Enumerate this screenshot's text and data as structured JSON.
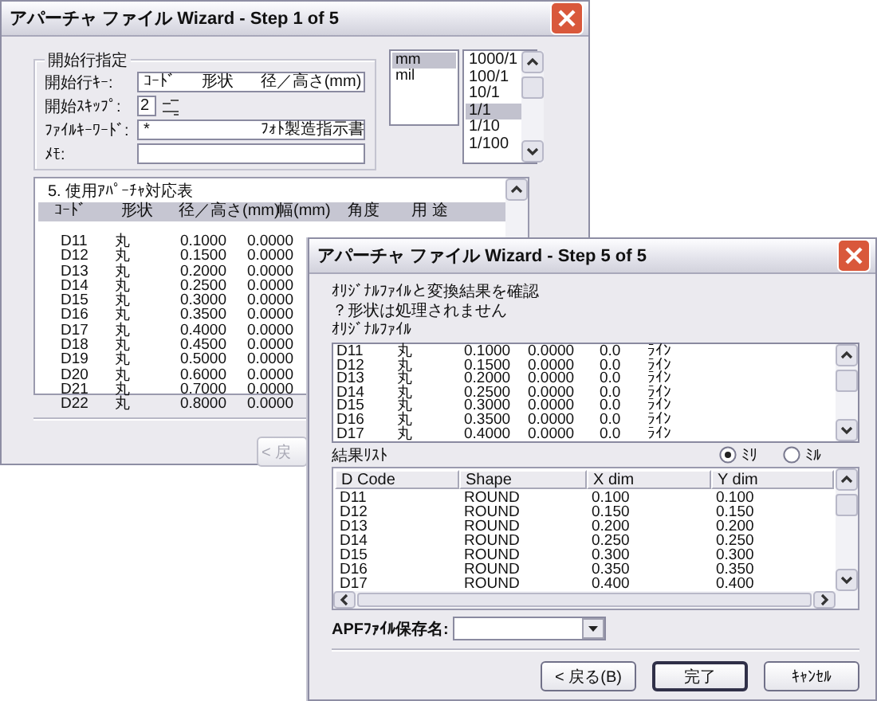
{
  "step1_window": {
    "title": "アパーチャ ファイル Wizard - Step 1 of 5",
    "start_group": {
      "title": "開始行指定",
      "fields": [
        {
          "kind": "text",
          "label": "開始行ｷｰ:",
          "value": "ｺｰﾄﾞ      形状      径／高さ(mm)"
        },
        {
          "kind": "spin",
          "label": "開始ｽｷｯﾌﾟ:",
          "value": "2"
        },
        {
          "kind": "text",
          "label": "ﾌｧｲﾙｷｰﾜｰﾄﾞ:",
          "value": "*                         ﾌｫﾄ製造指示書"
        },
        {
          "kind": "text",
          "label": "ﾒﾓ:"
        }
      ]
    },
    "unit_list": [
      {
        "label": "mm",
        "selected": true
      },
      {
        "label": "mil",
        "selected": false
      }
    ],
    "scale_list": [
      {
        "label": "1000/1",
        "selected": false
      },
      {
        "label": "100/1",
        "selected": false
      },
      {
        "label": "10/1",
        "selected": false
      },
      {
        "label": "1/1",
        "selected": true
      },
      {
        "label": "1/10",
        "selected": false
      },
      {
        "label": "1/100",
        "selected": false
      }
    ],
    "table": {
      "caption": "5. 使用ｱﾊﾟｰﾁｬ対応表",
      "columns": [
        "ｺｰﾄﾞ",
        "形状",
        "径／高さ(mm)",
        "幅(mm)",
        "角度",
        "用 途"
      ],
      "rows": [
        [
          "D11",
          "丸",
          "0.1000",
          "0.0000"
        ],
        [
          "D12",
          "丸",
          "0.1500",
          "0.0000"
        ],
        [
          "D13",
          "丸",
          "0.2000",
          "0.0000"
        ],
        [
          "D14",
          "丸",
          "0.2500",
          "0.0000"
        ],
        [
          "D15",
          "丸",
          "0.3000",
          "0.0000"
        ],
        [
          "D16",
          "丸",
          "0.3500",
          "0.0000"
        ],
        [
          "D17",
          "丸",
          "0.4000",
          "0.0000"
        ],
        [
          "D18",
          "丸",
          "0.4500",
          "0.0000"
        ],
        [
          "D19",
          "丸",
          "0.5000",
          "0.0000"
        ],
        [
          "D20",
          "丸",
          "0.6000",
          "0.0000"
        ],
        [
          "D21",
          "丸",
          "0.7000",
          "0.0000"
        ],
        [
          "D22",
          "丸",
          "0.8000",
          "0.0000"
        ]
      ]
    },
    "buttons": [
      {
        "label": "< 戻",
        "disabled": true
      }
    ]
  },
  "step5_window": {
    "title": "アパーチャ ファイル Wizard - Step 5 of 5",
    "messages": [
      "ｵﾘｼﾞﾅﾙﾌｧｲﾙと変換結果を確認",
      "？形状は処理されません"
    ],
    "original_label": "ｵﾘｼﾞﾅﾙﾌｧｲﾙ",
    "original_rows": [
      [
        "D11",
        "丸",
        "0.1000",
        "0.0000",
        "0.0",
        "ﾗｲﾝ"
      ],
      [
        "D12",
        "丸",
        "0.1500",
        "0.0000",
        "0.0",
        "ﾗｲﾝ"
      ],
      [
        "D13",
        "丸",
        "0.2000",
        "0.0000",
        "0.0",
        "ﾗｲﾝ"
      ],
      [
        "D14",
        "丸",
        "0.2500",
        "0.0000",
        "0.0",
        "ﾗｲﾝ"
      ],
      [
        "D15",
        "丸",
        "0.3000",
        "0.0000",
        "0.0",
        "ﾗｲﾝ"
      ],
      [
        "D16",
        "丸",
        "0.3500",
        "0.0000",
        "0.0",
        "ﾗｲﾝ"
      ],
      [
        "D17",
        "丸",
        "0.4000",
        "0.0000",
        "0.0",
        "ﾗｲﾝ"
      ]
    ],
    "results_label": "結果ﾘｽﾄ",
    "unit_radios": [
      {
        "label": "ﾐﾘ",
        "selected": true
      },
      {
        "label": "ﾐﾙ",
        "selected": false
      }
    ],
    "results_table": {
      "columns": [
        "D Code",
        "Shape",
        "X dim",
        "Y dim"
      ],
      "rows": [
        [
          "D11",
          "ROUND",
          "0.100",
          "0.100"
        ],
        [
          "D12",
          "ROUND",
          "0.150",
          "0.150"
        ],
        [
          "D13",
          "ROUND",
          "0.200",
          "0.200"
        ],
        [
          "D14",
          "ROUND",
          "0.250",
          "0.250"
        ],
        [
          "D15",
          "ROUND",
          "0.300",
          "0.300"
        ],
        [
          "D16",
          "ROUND",
          "0.350",
          "0.350"
        ],
        [
          "D17",
          "ROUND",
          "0.400",
          "0.400"
        ]
      ]
    },
    "save_label": "APFﾌｧｲﾙ保存名:",
    "buttons": [
      {
        "label": "< 戻る(B)",
        "default": false
      },
      {
        "label": "完了",
        "default": true
      },
      {
        "label": "ｷｬﾝｾﾙ",
        "default": false
      }
    ]
  }
}
